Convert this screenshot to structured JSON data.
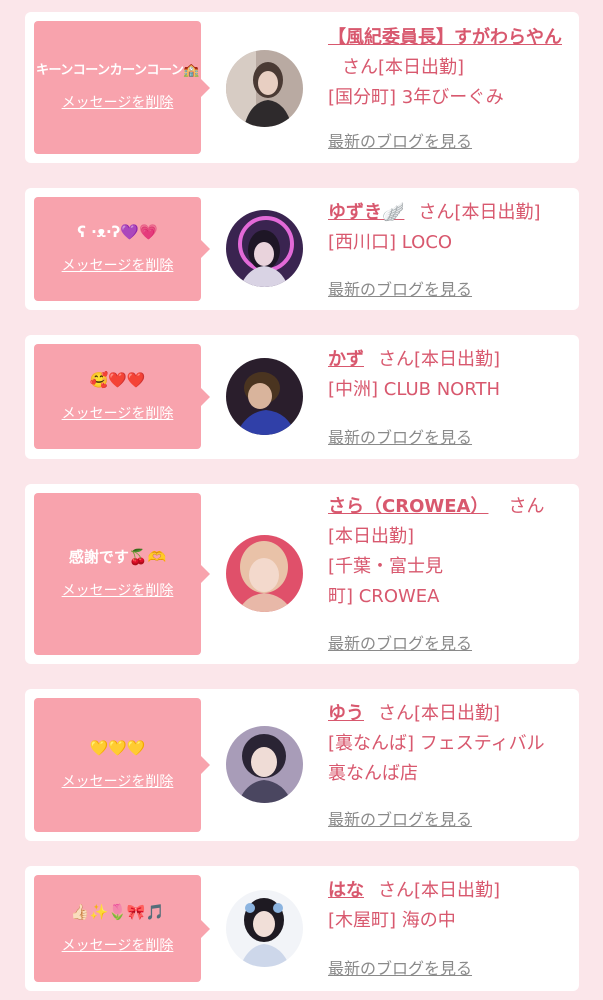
{
  "delete_label": "メッセージを削除",
  "blog_label": "最新のブログを見る",
  "san_label": "さん",
  "entries": [
    {
      "message": "キーンコーンカーンコーン🏫",
      "name": "【風紀委員長】すがわらやん",
      "status": "[本日出勤]",
      "location": "[国分町] 3年びーぐみ",
      "avatar_color": "#6d5a52"
    },
    {
      "message": "ʕ ·ᴥ·ʔ💜💗",
      "name": "ゆずき🪽",
      "status": "[本日出勤]",
      "location": "[西川口] LOCO",
      "avatar_color": "#5a3a7a"
    },
    {
      "message": "🥰❤️❤️",
      "name": "かず",
      "status": "[本日出勤]",
      "location": "[中洲] CLUB NORTH",
      "avatar_color": "#3a2a3a"
    },
    {
      "message": "感謝です🍒🫶",
      "name": "さら（CROWEA）",
      "status": "[本日出勤]",
      "location": "[千葉・富士見町] CROWEA",
      "location_line1": "[千葉・富士見",
      "location_line2": "町] CROWEA",
      "avatar_color": "#c98a80"
    },
    {
      "message": "💛💛💛",
      "name": "ゆう",
      "status": "[本日出勤]",
      "location": "[裏なんば] フェスティバル裏なんば店",
      "location_line1": "[裏なんば] フェスティバル",
      "location_line2": "裏なんば店",
      "avatar_color": "#8a7f9a"
    },
    {
      "message": "👍🏻✨🌷🎀🎵",
      "name": "はな",
      "status": "[本日出勤]",
      "location": "[木屋町] 海の中",
      "avatar_color": "#eef0f4"
    }
  ]
}
